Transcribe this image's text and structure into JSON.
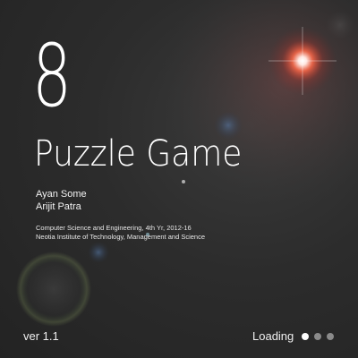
{
  "splash": {
    "number": "8",
    "title": "Puzzle Game",
    "authors": [
      "Ayan Some",
      "Arijit Patra"
    ],
    "department_line": "Computer Science and Engineering, 4th Yr, 2012-16",
    "institute_line": "Neotia Institute of Technology, Management and Science",
    "version": "ver 1.1",
    "loading_label": "Loading",
    "loading_dots_total": 3,
    "loading_dots_active": 1
  },
  "colors": {
    "background": "#2a2a2a",
    "text": "#ffffff",
    "lens_flare": "#ff5a3c",
    "dot_active": "#ffffff",
    "dot_idle": "#8a8a8a"
  },
  "icons": {
    "lens_flare": "lens-flare-icon",
    "loading_dot": "loading-dot-icon"
  }
}
